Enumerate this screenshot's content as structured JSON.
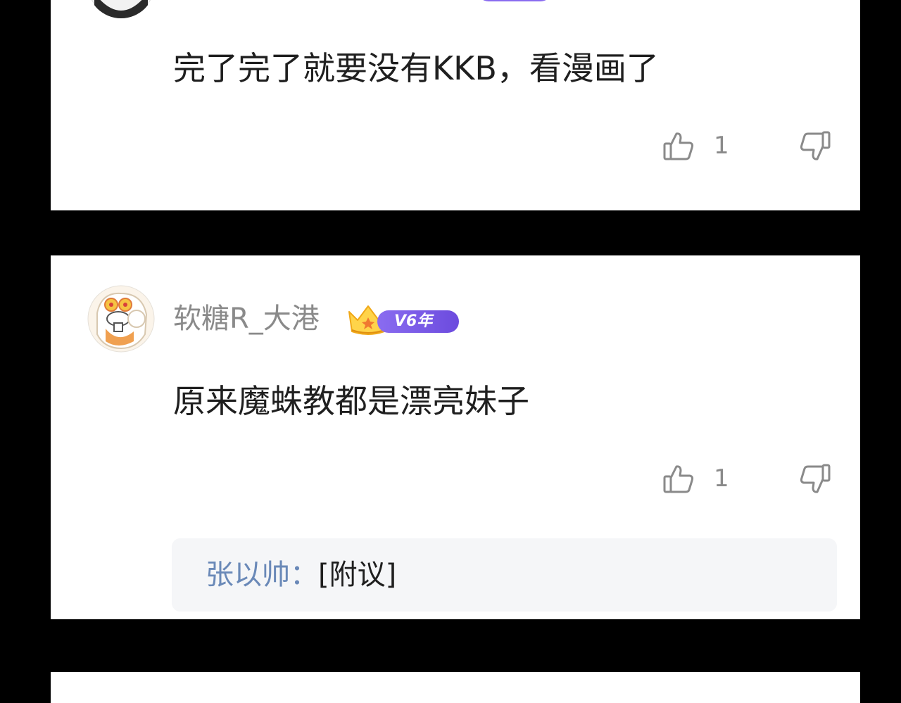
{
  "comments": [
    {
      "username": "",
      "text": "完了完了就要没有KKB，看漫画了",
      "likes": "1",
      "icons": {
        "like": "thumbs-up-icon",
        "dislike": "thumbs-down-icon"
      }
    },
    {
      "username": "软糖R_大港",
      "vip_badge": "V6年",
      "text": "原来魔蛛教都是漂亮妹子",
      "likes": "1",
      "icons": {
        "like": "thumbs-up-icon",
        "dislike": "thumbs-down-icon"
      },
      "reply": {
        "user": "张以帅",
        "separator": "：",
        "text": "[附议]"
      }
    }
  ],
  "colors": {
    "background": "#000000",
    "card": "#ffffff",
    "vip_badge": "#7a5ce8",
    "reply_user": "#6a89b8",
    "reply_box": "#f5f6f8"
  }
}
